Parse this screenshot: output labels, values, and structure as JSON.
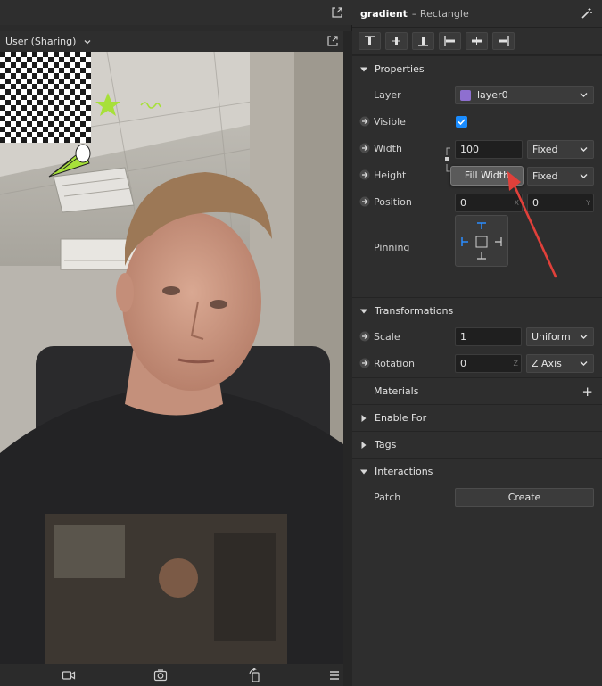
{
  "viewer": {
    "user_selector": "User (Sharing)"
  },
  "inspector": {
    "object_name": "gradient",
    "object_type": "– Rectangle",
    "sections": {
      "properties": "Properties",
      "transformations": "Transformations",
      "materials": "Materials",
      "enable_for": "Enable For",
      "tags": "Tags",
      "interactions": "Interactions"
    },
    "properties": {
      "layer_label": "Layer",
      "layer_value": "layer0",
      "visible_label": "Visible",
      "visible_checked": true,
      "width_label": "Width",
      "width_value": "100",
      "width_mode": "Fixed",
      "height_label": "Height",
      "height_mode": "Fixed",
      "position_label": "Position",
      "position_x": "0",
      "position_y": "0",
      "unit_x": "X",
      "unit_y": "Y",
      "pinning_label": "Pinning"
    },
    "tooltip": "Fill Width",
    "transformations": {
      "scale_label": "Scale",
      "scale_value": "1",
      "scale_mode": "Uniform",
      "rotation_label": "Rotation",
      "rotation_value": "0",
      "rotation_unit": "Z",
      "rotation_axis": "Z Axis"
    },
    "interactions": {
      "patch_label": "Patch",
      "create_label": "Create"
    }
  },
  "colors": {
    "accent_blue": "#1a8cff",
    "annotation_red": "#e0403a",
    "layer_purple": "#8e6fd0"
  }
}
